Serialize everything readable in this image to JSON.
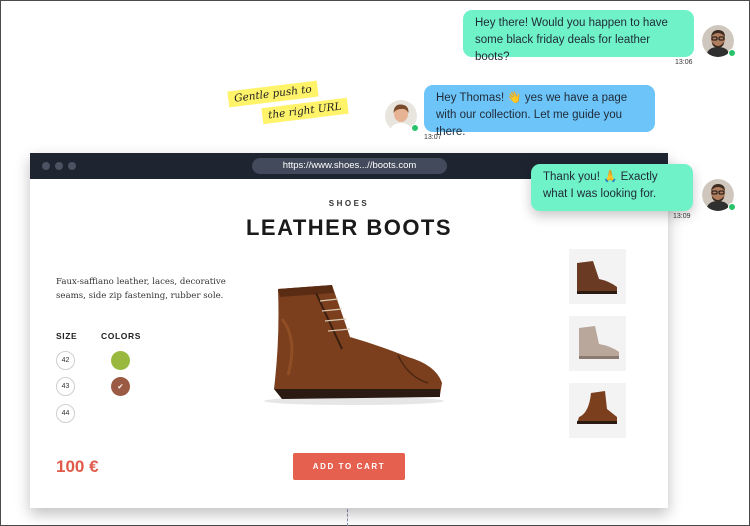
{
  "browser": {
    "url": "https://www.shoes...//boots.com"
  },
  "product": {
    "category": "SHOES",
    "title": "LEATHER BOOTS",
    "description": "Faux-saffiano leather, laces, decorative seams, side zip fastening, rubber sole.",
    "size_label": "SIZE",
    "colors_label": "COLORS",
    "sizes": [
      "42",
      "43",
      "44"
    ],
    "colors": [
      {
        "hex": "#98b93d",
        "selected": false
      },
      {
        "hex": "#9a5a43",
        "selected": true,
        "mark": "✔"
      }
    ],
    "price": "100 €",
    "cart_label": "ADD TO CART"
  },
  "notes": {
    "line1": "Gentle push to",
    "line2": "the right URL"
  },
  "chat": [
    {
      "text": "Hey there! Would you happen to have some black friday deals for leather boots?",
      "time": "13:06",
      "color": "#6ff2c8"
    },
    {
      "text": "Hey Thomas! 👋 yes we have a page with our collection. Let me guide you there.",
      "time": "13:07",
      "color": "#6dc4f9"
    },
    {
      "text": "Thank you! 🙏 Exactly what I was looking for.",
      "time": "13:09",
      "color": "#6ff2c8"
    }
  ],
  "icons": {
    "status": "online-status-icon",
    "boot": "leather-boot-image"
  },
  "colors": {
    "accent": "#e5604f",
    "titlebar": "#1e2430",
    "online": "#27c26a"
  }
}
